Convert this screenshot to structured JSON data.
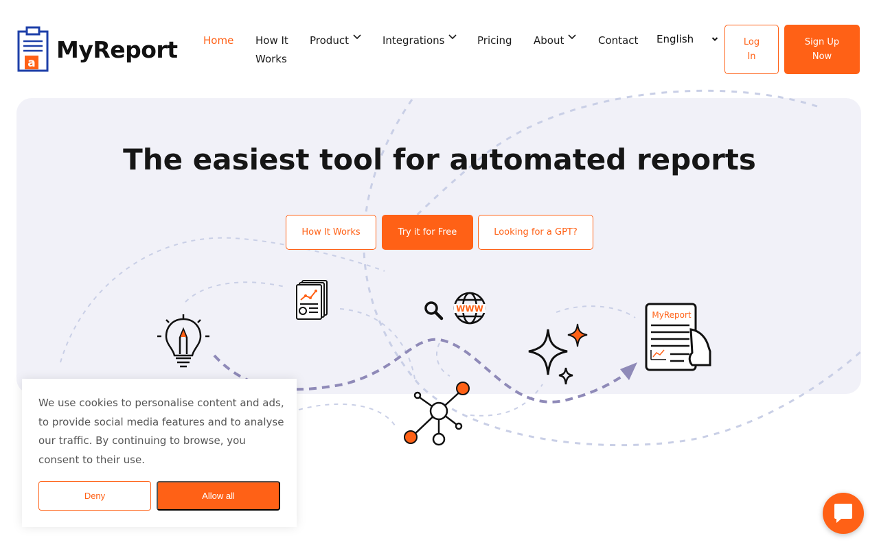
{
  "header": {
    "brand": "MyReport",
    "nav": [
      {
        "label": "Home"
      },
      {
        "label": "How It Works"
      },
      {
        "label": "Product"
      },
      {
        "label": "Integrations"
      },
      {
        "label": "Pricing"
      },
      {
        "label": "About"
      },
      {
        "label": "Contact"
      }
    ],
    "language": "English",
    "login_label": "Log In",
    "signup_label": "Sign Up Now"
  },
  "hero": {
    "title": "The easiest tool for automated reports",
    "buttons": [
      {
        "label": "How It Works"
      },
      {
        "label": "Try it for Free"
      },
      {
        "label": "Looking for a GPT?"
      }
    ],
    "illustration_icons": [
      "lightbulb-icon",
      "report-documents-icon",
      "magnifier-icon",
      "www-globe-icon",
      "network-nodes-icon",
      "sparkles-icon",
      "myreport-document-icon"
    ],
    "report_doc_label": "MyReport"
  },
  "cookie_banner": {
    "text": "We use cookies to personalise content and ads, to provide social media features and to analyse our traffic. By continuing to browse, you consent to their use.",
    "deny_label": "Deny",
    "allow_label": "Allow all"
  },
  "chat_widget": {
    "icon": "chat-bubble-icon"
  },
  "colors": {
    "accent": "#ff6116",
    "hero_bg": "#f1f1f8",
    "dashed_line": "#c9cfe6",
    "path_purple": "#8f8ab8",
    "brand_blue": "#1d3fa8"
  }
}
